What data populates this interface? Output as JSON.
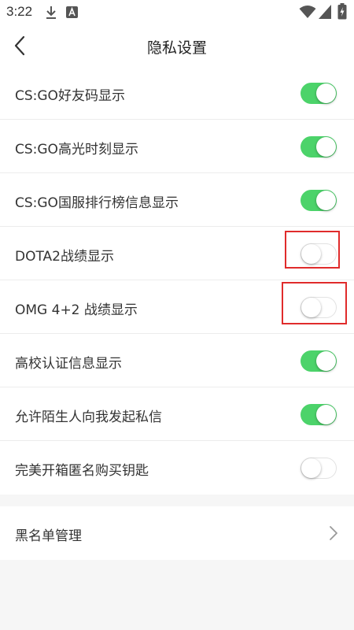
{
  "status_bar": {
    "time": "3:22",
    "icons": [
      "download-icon",
      "app-a-icon",
      "wifi-icon",
      "signal-icon",
      "battery-icon"
    ]
  },
  "header": {
    "title": "隐私设置",
    "back_icon": "chevron-left-icon"
  },
  "settings": [
    {
      "label": "CS:GO好友码显示",
      "enabled": true,
      "highlighted": false
    },
    {
      "label": "CS:GO高光时刻显示",
      "enabled": true,
      "highlighted": false
    },
    {
      "label": "CS:GO国服排行榜信息显示",
      "enabled": true,
      "highlighted": false
    },
    {
      "label": "DOTA2战绩显示",
      "enabled": false,
      "highlighted": true
    },
    {
      "label": "OMG 4+2 战绩显示",
      "enabled": false,
      "highlighted": true
    },
    {
      "label": "高校认证信息显示",
      "enabled": true,
      "highlighted": false
    },
    {
      "label": "允许陌生人向我发起私信",
      "enabled": true,
      "highlighted": false
    },
    {
      "label": "完美开箱匿名购买钥匙",
      "enabled": false,
      "highlighted": false
    }
  ],
  "blacklist": {
    "label": "黑名单管理",
    "icon": "chevron-right-icon"
  },
  "colors": {
    "toggle_on": "#4cd36a",
    "highlight": "#e02b2b",
    "background": "#f6f6f6"
  }
}
